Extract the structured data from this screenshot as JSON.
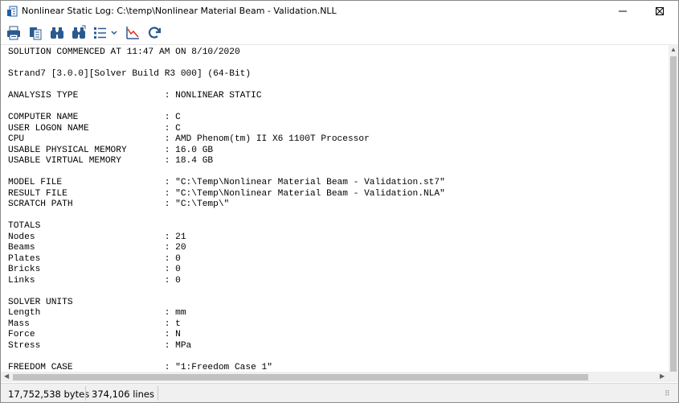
{
  "window": {
    "title": "Nonlinear Static Log: C:\\temp\\Nonlinear Material Beam - Validation.NLL"
  },
  "toolbar": {
    "buttons": [
      {
        "name": "print-icon"
      },
      {
        "name": "copy-icon"
      },
      {
        "name": "find-icon"
      },
      {
        "name": "find-next-icon"
      },
      {
        "name": "list-options-icon"
      },
      {
        "name": "graph-icon"
      },
      {
        "name": "refresh-icon"
      }
    ]
  },
  "log": {
    "text": "SOLUTION COMMENCED AT 11:47 AM ON 8/10/2020\n\nStrand7 [3.0.0][Solver Build R3 000] (64-Bit)\n\nANALYSIS TYPE                : NONLINEAR STATIC\n\nCOMPUTER NAME                : C\nUSER LOGON NAME              : C\nCPU                          : AMD Phenom(tm) II X6 1100T Processor\nUSABLE PHYSICAL MEMORY       : 16.0 GB\nUSABLE VIRTUAL MEMORY        : 18.4 GB\n\nMODEL FILE                   : \"C:\\Temp\\Nonlinear Material Beam - Validation.st7\"\nRESULT FILE                  : \"C:\\Temp\\Nonlinear Material Beam - Validation.NLA\"\nSCRATCH PATH                 : \"C:\\Temp\\\"\n\nTOTALS\nNodes                        : 21\nBeams                        : 20\nPlates                       : 0\nBricks                       : 0\nLinks                        : 0\n\nSOLVER UNITS\nLength                       : mm\nMass                         : t\nForce                        : N\nStress                       : MPa\n\nFREEDOM CASE                 : \"1:Freedom Case 1\""
  },
  "status": {
    "size": "17,752,538 bytes",
    "lines": "374,106 lines"
  }
}
